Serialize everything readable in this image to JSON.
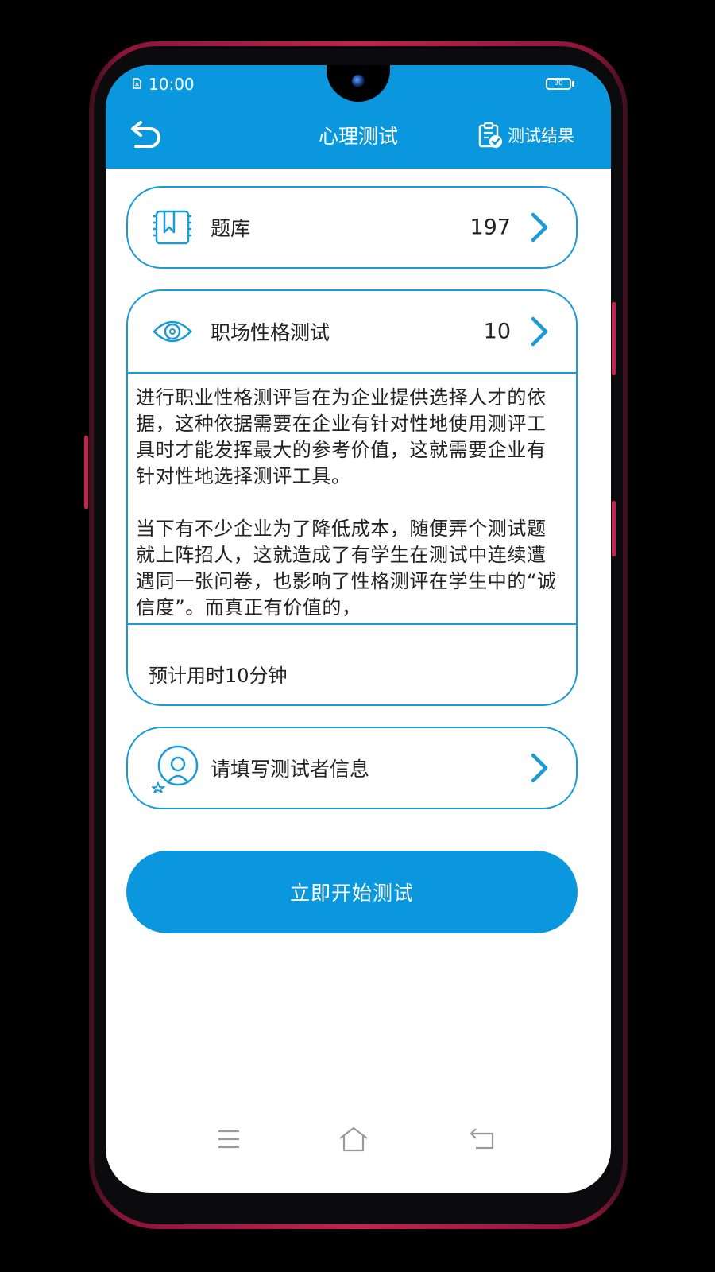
{
  "status": {
    "time": "10:00",
    "battery": "90"
  },
  "header": {
    "title": "心理测试",
    "results_label": "测试结果"
  },
  "items": {
    "question_bank": {
      "label": "题库",
      "count": "197"
    },
    "workplace_test": {
      "label": "职场性格测试",
      "count": "10",
      "description": [
        "进行职业性格测评旨在为企业提供选择人才的依据，这种依据需要在企业有针对性地使用测评工具时才能发挥最大的参考价值，这就需要企业有针对性地选择测评工具。",
        "当下有不少企业为了降低成本，随便弄个测试题就上阵招人，这就造成了有学生在测试中连续遭遇同一张问卷，也影响了性格测评在学生中的“诚信度”。而真正有价值的，"
      ],
      "duration": "预计用时10分钟"
    },
    "tester_info": {
      "label": "请填写测试者信息"
    }
  },
  "start_button": "立即开始测试",
  "colors": {
    "accent": "#0a97de",
    "border": "#1a9bd8",
    "frame": "#c4224f"
  },
  "icons": [
    "back-icon",
    "clipboard-check-icon",
    "question-bank-icon",
    "eye-icon",
    "user-profile-icon",
    "chevron-right-icon",
    "menu-icon",
    "home-icon",
    "nav-back-icon"
  ]
}
